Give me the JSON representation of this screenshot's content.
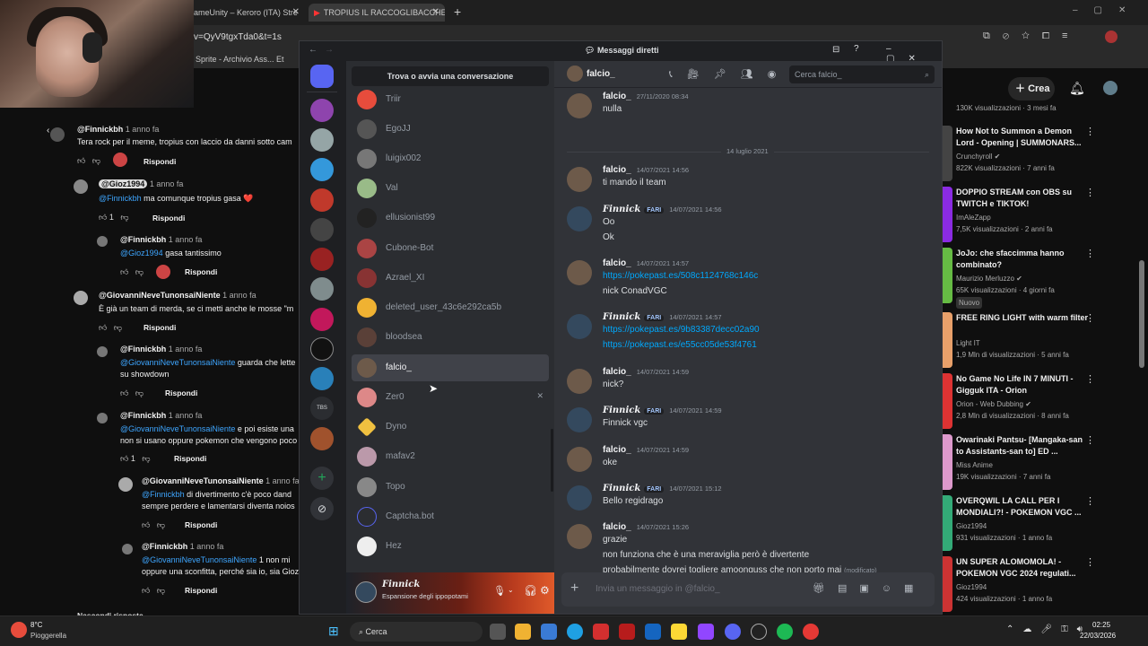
{
  "browser": {
    "tabs": [
      {
        "label": "ameUnity – Keroro (ITA) Stre"
      },
      {
        "label": "TROPIUS IL RACCOGLIBACCHE!"
      }
    ],
    "url": "v=QyV9tgxTda0&t=1s",
    "bookmarks": [
      "Sprite - Archivio Ass...",
      "Et"
    ]
  },
  "youtube": {
    "create_label": "Crea",
    "comments": [
      {
        "user": "@Finnickbh",
        "meta": "1 anno fa",
        "text": "Tera rock per il meme, tropius con laccio da danni sotto cam",
        "reply": "Rispondi"
      },
      {
        "user": "@Gioz1994",
        "meta": "1 anno fa",
        "mention": "@Finnickbh",
        "text": "ma comunque tropius gasa ❤️",
        "likes": "1",
        "reply": "Rispondi"
      },
      {
        "user": "@Finnickbh",
        "meta": "1 anno fa",
        "mention": "@Gioz1994",
        "text": "gasa tantissimo",
        "reply": "Rispondi"
      },
      {
        "user": "@GiovanniNeveTunonsaiNiente",
        "meta": "1 anno fa",
        "text": "È già un team di merda, se ci metti anche le mosse \"m",
        "reply": "Rispondi"
      },
      {
        "user": "@Finnickbh",
        "meta": "1 anno fa",
        "mention": "@GiovanniNeveTunonsaiNiente",
        "text": "guarda che lette",
        "text2": "su showdown",
        "reply": "Rispondi"
      },
      {
        "user": "@Finnickbh",
        "meta": "1 anno fa",
        "mention": "@GiovanniNeveTunonsaiNiente",
        "text": "e poi esiste una",
        "text2": "non si usano oppure pokemon che vengono poco",
        "likes": "1",
        "reply": "Rispondi"
      },
      {
        "user": "@GiovanniNeveTunonsaiNiente",
        "meta": "1 anno fa",
        "mention": "@Finnickbh",
        "text": "di divertimento c'è poco dand",
        "text2": "sempre perdere e lamentarsi diventa noios",
        "reply": "Rispondi"
      },
      {
        "user": "@Finnickbh",
        "meta": "1 anno fa",
        "mention": "@GiovanniNeveTunonsaiNiente",
        "text": "1 non mi",
        "text2": "oppure una sconfitta, perché sia io, sia Gioz",
        "reply": "Rispondi"
      }
    ],
    "hidden_replies": "Nascondi risposte",
    "sidebar": [
      {
        "title": "",
        "channel": "130K visualizzazioni · 3 mesi fa"
      },
      {
        "title": "How Not to Summon a Demon Lord - Opening | SUMMONARS...",
        "channel": "Crunchyroll ✔",
        "stats": "822K visualizzazioni · 7 anni fa"
      },
      {
        "title": "DOPPIO STREAM con OBS su TWITCH e TIKTOK!",
        "channel": "ImAleZapp",
        "stats": "7,5K visualizzazioni · 2 anni fa"
      },
      {
        "title": "JoJo: che sfaccimma hanno combinato?",
        "channel": "Maurizio Merluzzo ✔",
        "stats": "65K visualizzazioni · 4 giorni fa",
        "badge": "Nuovo"
      },
      {
        "title": "FREE RING LIGHT with warm filter",
        "channel": "Light IT",
        "stats": "1,9 Mln di visualizzazioni · 5 anni fa"
      },
      {
        "title": "No Game No Life IN 7 MINUTI - Gigguk ITA - Orion",
        "channel": "Orion - Web Dubbing ✔",
        "stats": "2,8 Mln di visualizzazioni · 8 anni fa"
      },
      {
        "title": "Owarinaki Pantsu- [Mangaka-san to Assistants-san to] ED ...",
        "channel": "Miss Anime",
        "stats": "19K visualizzazioni · 7 anni fa"
      },
      {
        "title": "OVERQWIL LA CALL PER I MONDIALI?! - POKEMON VGC ...",
        "channel": "Gioz1994",
        "stats": "931 visualizzazioni · 1 anno fa"
      },
      {
        "title": "UN SUPER ALOMOMOLA! - POKEMON VGC 2024 regulati...",
        "channel": "Gioz1994",
        "stats": "424 visualizzazioni · 1 anno fa"
      }
    ]
  },
  "discord": {
    "title": "Messaggi diretti",
    "dm_search": "Trova o avvia una conversazione",
    "dms": [
      "Triir",
      "EgoJJ",
      "luigix002",
      "Val",
      "ellusionist99",
      "Cubone-Bot",
      "Azrael_XI",
      "deleted_user_43c6e292ca5b",
      "bloodsea",
      "falcio_",
      "Zer0",
      "Dyno",
      "mafav2",
      "Topo",
      "Captcha.bot",
      "Hez"
    ],
    "selected_dm": "falcio_",
    "guild_labels": {
      "tbs": "TBS"
    },
    "user": {
      "name": "Finnick",
      "status": "Espansione degli ippopotami"
    },
    "chat": {
      "channel": "falcio_",
      "search_placeholder": "Cerca falcio_",
      "date_separator": "14 luglio 2021",
      "input_placeholder": "Invia un messaggio in @falcio_",
      "messages": [
        {
          "author": "falcio_",
          "time": "27/11/2020 08:34",
          "lines": [
            "nulla"
          ]
        },
        {
          "author": "falcio_",
          "time": "14/07/2021 14:56",
          "lines": [
            "ti mando il team"
          ]
        },
        {
          "author": "Finnick",
          "tag": "FARI",
          "time": "14/07/2021 14:56",
          "lines": [
            "Oo",
            "Ok"
          ]
        },
        {
          "author": "falcio_",
          "time": "14/07/2021 14:57",
          "lines": [
            "https://pokepast.es/508c1124768c146c",
            "nick ConadVGC"
          ]
        },
        {
          "author": "Finnick",
          "tag": "FARI",
          "time": "14/07/2021 14:57",
          "lines": [
            "https://pokepast.es/9b83387decc02a90",
            "https://pokepast.es/e55cc05de53f4761"
          ]
        },
        {
          "author": "falcio_",
          "time": "14/07/2021 14:59",
          "lines": [
            "nick?"
          ]
        },
        {
          "author": "Finnick",
          "tag": "FARI",
          "time": "14/07/2021 14:59",
          "lines": [
            "Finnick vgc"
          ]
        },
        {
          "author": "falcio_",
          "time": "14/07/2021 14:59",
          "lines": [
            "oke"
          ]
        },
        {
          "author": "Finnick",
          "tag": "FARI",
          "time": "14/07/2021 15:12",
          "lines": [
            "Bello regidrago"
          ]
        },
        {
          "author": "falcio_",
          "time": "14/07/2021 15:26",
          "lines": [
            "grazie",
            "non funziona che è una meraviglia però è divertente",
            "probabilmente dovrei togliere amoonguss che non porto mai"
          ],
          "edited": "(modificato)"
        }
      ]
    }
  },
  "taskbar": {
    "weather_temp": "8°C",
    "weather_desc": "Pioggerella",
    "search": "Cerca",
    "time": "02:25",
    "date": "22/03/2026"
  }
}
